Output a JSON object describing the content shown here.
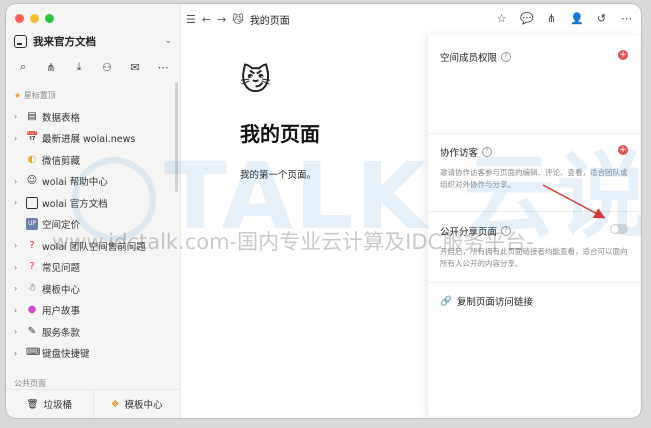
{
  "window": {
    "traffic_colors": [
      "#ff5f57",
      "#febc2e",
      "#28c840"
    ]
  },
  "sidebar": {
    "workspace_name": "我来官方文档",
    "starred_label": "星标置顶",
    "public_label": "公共页面",
    "items": [
      {
        "label": "数据表格",
        "icon": "table-icon"
      },
      {
        "label": "最新进展 wolai.news",
        "icon": "calendar-icon"
      },
      {
        "label": "微信剪藏",
        "icon": "wechat-icon"
      },
      {
        "label": "wolai 帮助中心",
        "icon": "avatar-icon"
      },
      {
        "label": "wolai 官方文档",
        "icon": "doc-icon"
      },
      {
        "label": "空间定价",
        "icon": "up-icon"
      },
      {
        "label": "wolai 团队空间售前问题",
        "icon": "question-icon"
      },
      {
        "label": "常见问题",
        "icon": "question-icon"
      },
      {
        "label": "模板中心",
        "icon": "template-icon"
      },
      {
        "label": "用户故事",
        "icon": "story-icon"
      },
      {
        "label": "服务条款",
        "icon": "terms-icon"
      },
      {
        "label": "键盘快捷键",
        "icon": "keyboard-icon"
      }
    ],
    "bottom": {
      "trash": "垃圾桶",
      "templates": "模板中心"
    }
  },
  "topbar": {
    "breadcrumb_title": "我的页面"
  },
  "page": {
    "emoji": "😼",
    "title": "我的页面",
    "body": "我的第一个页面。"
  },
  "panel": {
    "members_title": "空间成员权限",
    "guests_title": "协作访客",
    "guests_desc": "邀请协作访客参与页面的编辑、评论、查看，适合团队或组织对外协作与分享。",
    "public_title": "公开分享页面",
    "public_desc": "开启后，所有拥有此页面链接者均能查看，适合可以面向所有人公开的内容分享。",
    "copy_link": "复制页面访问链接",
    "accent_color": "#e05050"
  },
  "watermark": {
    "line1": "TALK 云说",
    "line2": "www.idctalk.com-国内专业云计算及IDC服务平台-"
  }
}
